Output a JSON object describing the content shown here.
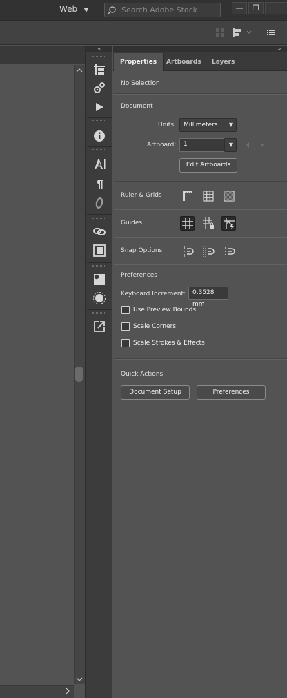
{
  "topbar": {
    "workspace": "Web",
    "search_placeholder": "Search Adobe Stock",
    "minimize": "—",
    "restore": "❐"
  },
  "dock": {
    "collapse_glyph": "«",
    "icons": [
      "artboards-icon",
      "asset-export-icon",
      "actions-icon",
      "info-icon",
      "character-icon",
      "paragraph-icon",
      "opentype-icon",
      "links-icon",
      "libraries-icon",
      "appearance-icon",
      "color-guide-icon",
      "export-icon"
    ]
  },
  "panel": {
    "expand_glyph": "»",
    "tabs": [
      {
        "label": "Properties",
        "active": true
      },
      {
        "label": "Artboards",
        "active": false
      },
      {
        "label": "Layers",
        "active": false
      }
    ],
    "no_selection": "No Selection",
    "document": {
      "title": "Document",
      "units_label": "Units:",
      "units_value": "Millimeters",
      "artboard_label": "Artboard:",
      "artboard_value": "1",
      "edit_artboards": "Edit Artboards"
    },
    "ruler_grids": "Ruler & Grids",
    "guides": "Guides",
    "snap_options": "Snap Options",
    "preferences": {
      "title": "Preferences",
      "keyboard_increment_label": "Keyboard Increment:",
      "keyboard_increment_value": "0.3528 mm",
      "use_preview_bounds": "Use Preview Bounds",
      "scale_corners": "Scale Corners",
      "scale_strokes": "Scale Strokes & Effects"
    },
    "quick_actions": {
      "title": "Quick Actions",
      "document_setup": "Document Setup",
      "preferences": "Preferences"
    }
  },
  "colors": {
    "panel_bg": "#535353",
    "dark_bg": "#323232",
    "text": "#e6e6e6"
  }
}
